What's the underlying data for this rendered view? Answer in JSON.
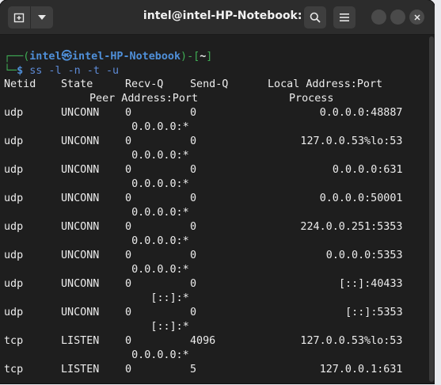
{
  "window": {
    "title": "intel@intel-HP-Notebook: ~"
  },
  "prompt": {
    "corner": "┌──",
    "open": "(",
    "user": "intel",
    "at": "㉿",
    "host": "intel-HP-Notebook",
    "close": ")-[",
    "dir": "~",
    "dir_close": "]",
    "corner2": "└─",
    "dollar": "$",
    "command": "ss -l -n -t -u"
  },
  "header": {
    "netid": "Netid",
    "state": "State",
    "recvq": "Recv-Q",
    "sendq": "Send-Q",
    "local": "Local Address:Port",
    "peer": "Peer Address:Port",
    "process": "Process"
  },
  "rows": [
    {
      "netid": "udp",
      "state": "UNCONN",
      "recvq": "0",
      "sendq": "0",
      "local": "0.0.0.0:48887",
      "peer": "0.0.0.0:*"
    },
    {
      "netid": "udp",
      "state": "UNCONN",
      "recvq": "0",
      "sendq": "0",
      "local": "127.0.0.53%lo:53",
      "peer": "0.0.0.0:*"
    },
    {
      "netid": "udp",
      "state": "UNCONN",
      "recvq": "0",
      "sendq": "0",
      "local": "0.0.0.0:631",
      "peer": "0.0.0.0:*"
    },
    {
      "netid": "udp",
      "state": "UNCONN",
      "recvq": "0",
      "sendq": "0",
      "local": "0.0.0.0:50001",
      "peer": "0.0.0.0:*"
    },
    {
      "netid": "udp",
      "state": "UNCONN",
      "recvq": "0",
      "sendq": "0",
      "local": "224.0.0.251:5353",
      "peer": "0.0.0.0:*"
    },
    {
      "netid": "udp",
      "state": "UNCONN",
      "recvq": "0",
      "sendq": "0",
      "local": "0.0.0.0:5353",
      "peer": "0.0.0.0:*"
    },
    {
      "netid": "udp",
      "state": "UNCONN",
      "recvq": "0",
      "sendq": "0",
      "local": "[::]:40433",
      "peer": "[::]:*"
    },
    {
      "netid": "udp",
      "state": "UNCONN",
      "recvq": "0",
      "sendq": "0",
      "local": "[::]:5353",
      "peer": "[::]:*"
    },
    {
      "netid": "tcp",
      "state": "LISTEN",
      "recvq": "0",
      "sendq": "4096",
      "local": "127.0.0.53%lo:53",
      "peer": "0.0.0.0:*"
    },
    {
      "netid": "tcp",
      "state": "LISTEN",
      "recvq": "0",
      "sendq": "5",
      "local": "127.0.0.1:631",
      "peer": ""
    }
  ]
}
